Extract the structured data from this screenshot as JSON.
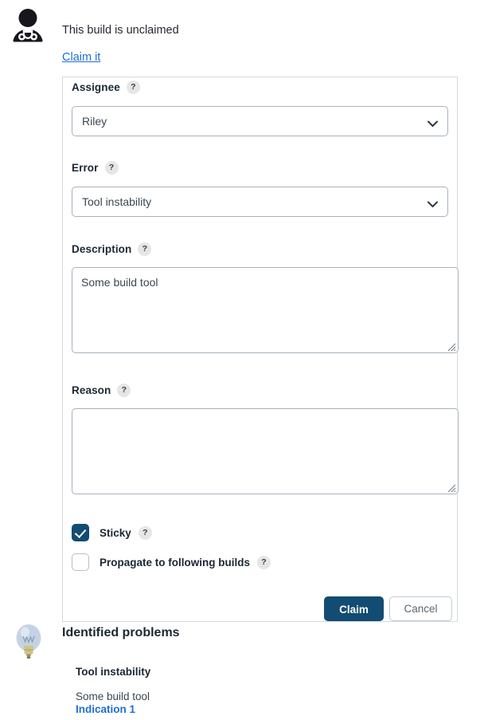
{
  "banner": {
    "icon": "doctor-icon",
    "status_text": "This build is unclaimed",
    "claim_link": "Claim it"
  },
  "form": {
    "fields": [
      {
        "label": "Assignee",
        "help": "?",
        "control": "select",
        "value": "Riley",
        "options": [
          "Riley"
        ]
      },
      {
        "label": "Error",
        "help": "?",
        "control": "select",
        "value": "Tool instability",
        "options": [
          "Tool instability"
        ]
      },
      {
        "label": "Description",
        "help": "?",
        "control": "textarea",
        "value": "Some build tool",
        "placeholder": ""
      },
      {
        "label": "Reason",
        "help": "?",
        "control": "textarea",
        "value": "",
        "placeholder": ""
      }
    ],
    "checkboxes": [
      {
        "label": "Sticky",
        "help": "?",
        "checked": true
      },
      {
        "label": "Propagate to following builds",
        "help": "?",
        "checked": false
      }
    ],
    "buttons": {
      "submit_label": "Claim",
      "cancel_label": "Cancel"
    }
  },
  "identified_problems": {
    "icon": "lightbulb-icon",
    "title": "Identified problems",
    "items": [
      {
        "name": "Tool instability",
        "description": "Some build tool",
        "link_label": "Indication 1"
      }
    ]
  },
  "colors": {
    "accent": "#134c72",
    "link": "#1f6fd0",
    "border": "#a7b3bd",
    "panel_border": "#d6dade",
    "text": "#1b2733"
  }
}
